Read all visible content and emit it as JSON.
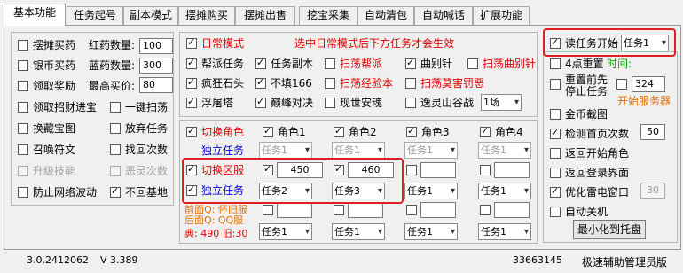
{
  "tabs": [
    "基本功能",
    "任务起号",
    "副本模式",
    "摆摊购买",
    "摆摊出售",
    "挖宝采集",
    "自动清包",
    "自动喊话",
    "扩展功能"
  ],
  "left": {
    "buy_hp": "摆摊买药",
    "silver_hp": "银币买药",
    "claim_reward": "领取奖励",
    "claim_treasury": "领取招财进宝",
    "exchange_treasure": "换藏宝图",
    "summon_beast": "召唤符文",
    "upgrade_skill": "升级技能",
    "anti_lag": "防止网络波动",
    "red_qty_label": "红药数量:",
    "red_qty": "100",
    "blue_qty_label": "蓝药数量:",
    "blue_qty": "300",
    "max_price_label": "最高买价:",
    "max_price": "80",
    "one_click_sweep": "一键扫荡",
    "abandon_task": "放弃任务",
    "find_times": "找回次数",
    "evil_times": "恶灵次数",
    "no_return": "不回基地"
  },
  "middle": {
    "daily_mode": "日常模式",
    "daily_hint": "选中日常模式后下方任务才会生效",
    "rows": [
      [
        "帮派任务",
        "任务副本",
        "扫荡帮派",
        "曲别针",
        "扫荡曲别针"
      ],
      [
        "疯狂石头",
        "不填166",
        "扫荡经验本",
        "扫荡莫害罚恶"
      ],
      [
        "浮屠塔",
        "巅峰对决",
        "现世安魂",
        "逸灵山谷战"
      ]
    ],
    "field_sel": "1场",
    "switch_role": "切换角色",
    "independent": "独立任务",
    "roles": [
      "角色1",
      "角色2",
      "角色3",
      "角色4"
    ],
    "task_opt": "任务1",
    "switch_server": "切换区服",
    "server1": "450",
    "server2": "460",
    "independent2": "独立任务",
    "t2": "任务2",
    "t3": "任务3",
    "front_hint1": "前面Q: 怀旧服",
    "front_hint2": "后面Q: QQ服",
    "dian_label": "典: 490 旧:30"
  },
  "right": {
    "read_task_start": "读任务开始",
    "task_opt": "任务1",
    "reset_4": "4点重置",
    "time_label": "时间:",
    "reset_prev": "重置前先",
    "stop_task": "停止任务",
    "reset_val": "324",
    "start_server": "开始服务器",
    "gold_shot": "金币截图",
    "check_home": "检测首页次数",
    "check_home_val": "50",
    "back_start_role": "返回开始角色",
    "back_login": "返回登录界面",
    "optimize_thunder": "优化雷电窗口",
    "optimize_val": "30",
    "auto_shutdown": "自动关机",
    "minimize_tray": "最小化到托盘"
  },
  "status": {
    "version": "3.0.2412062",
    "v": "V 3.389",
    "qq": "33663145",
    "edition": "极速辅助管理员版"
  }
}
